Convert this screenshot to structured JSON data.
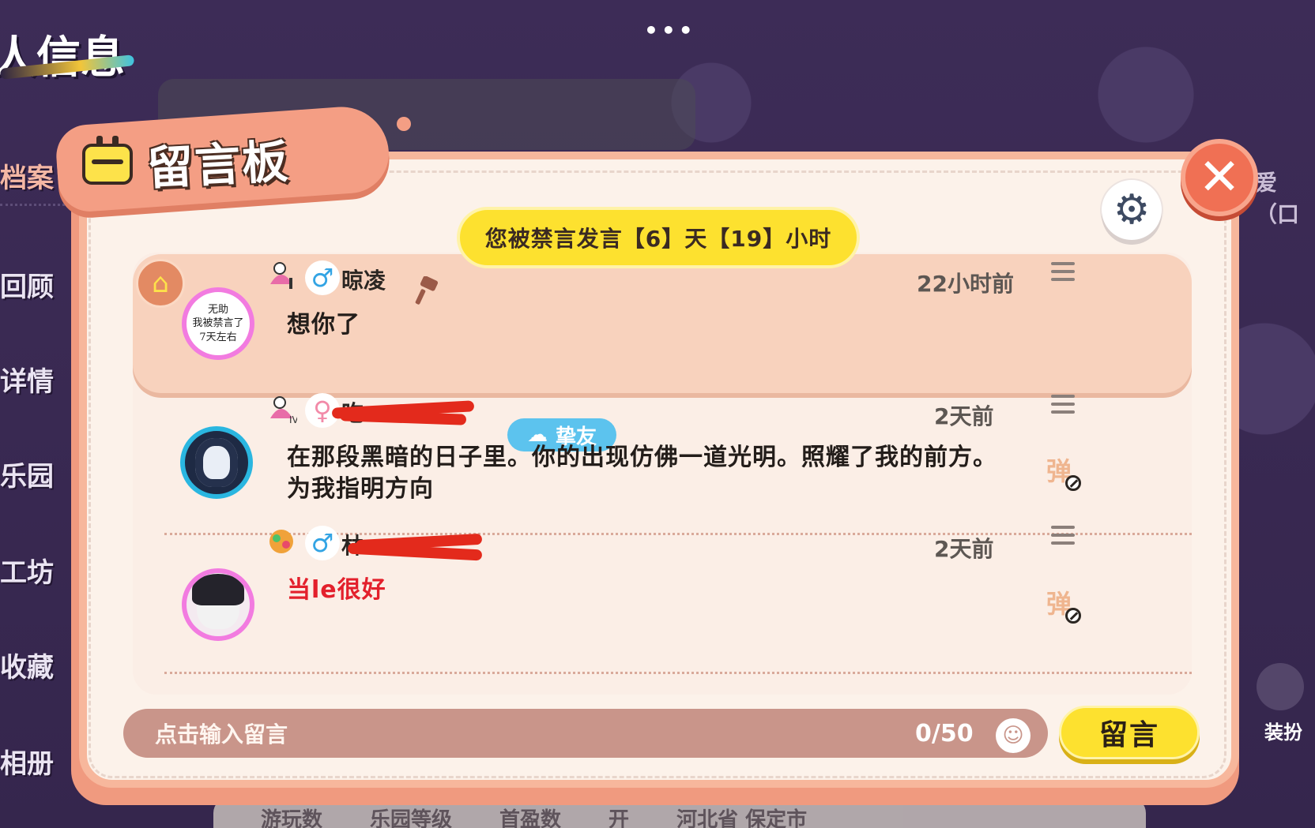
{
  "background": {
    "page_title": "人信息",
    "sidebar": [
      {
        "label": "档案",
        "active": true
      },
      {
        "label": "回顾"
      },
      {
        "label": "详情"
      },
      {
        "label": "乐园"
      },
      {
        "label": "工坊"
      },
      {
        "label": "收藏"
      },
      {
        "label": "相册"
      }
    ],
    "top_dots": "•••",
    "right_fragment": "爱（口",
    "dressup_label": "装扮",
    "bottom_stats": [
      "游玩数",
      "乐园等级",
      "首盈数",
      "开",
      "河北省 保定市"
    ]
  },
  "board": {
    "title": "留言板",
    "ban_notice": "您被禁言发言【6】天【19】小时",
    "close_symbol": "✕",
    "settings_symbol": "⚙"
  },
  "messages": [
    {
      "username": "晾凌",
      "avatar_text": [
        "无助",
        "我被禁言了",
        "7天左右"
      ],
      "time": "22小时前",
      "text": "想你了",
      "own": true,
      "gender": "♂"
    },
    {
      "username": "吃",
      "username_redacted": true,
      "badge": "挚友",
      "time": "2天前",
      "text": "在那段黑暗的日子里。你的出现仿佛一道光明。照耀了我的前方。",
      "text2": "为我指明方向",
      "danmu": "弹",
      "gender": "♀"
    },
    {
      "username": "林",
      "username_redacted": true,
      "time": "2天前",
      "text": "当le很好",
      "text_color": "#e3202c",
      "danmu": "弹",
      "gender": "♂"
    }
  ],
  "input": {
    "placeholder": "点击输入留言",
    "counter": "0/50",
    "send_label": "留言"
  },
  "colors": {
    "accent_yellow": "#fde12f",
    "modal_border": "#f7b79c",
    "close_red": "#f07054",
    "friend_blue": "#5cc3ee",
    "gender_blue": "#33a4e4"
  }
}
